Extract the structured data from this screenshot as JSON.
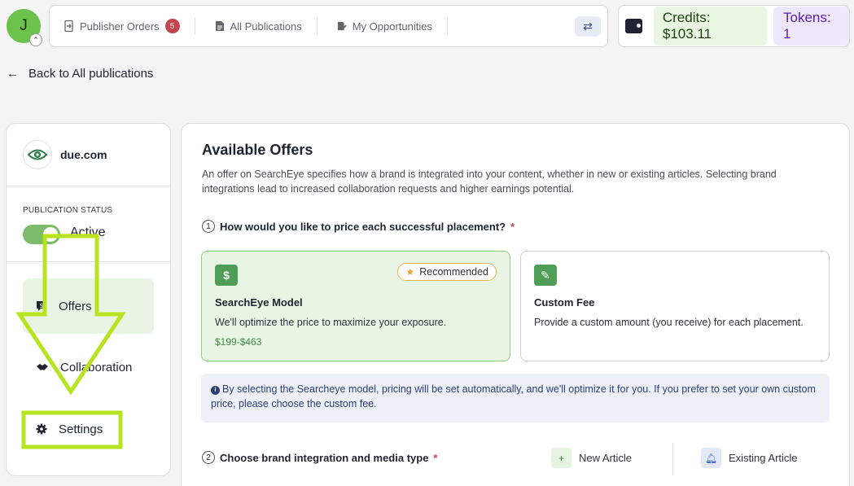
{
  "user": {
    "initial": "J"
  },
  "nav": {
    "items": [
      {
        "label": "Publisher Orders",
        "badge": "5"
      },
      {
        "label": "All Publications"
      },
      {
        "label": "My Opportunities"
      }
    ]
  },
  "wallet": {
    "credits": "Credits: $103.11",
    "tokens": "Tokens: 1"
  },
  "back_link": "Back to All publications",
  "publication": {
    "name": "due.com",
    "status_label": "PUBLICATION STATUS",
    "status": "Active"
  },
  "menu": [
    {
      "label": "Offers",
      "active": true
    },
    {
      "label": "Collaboration"
    },
    {
      "label": "Settings"
    }
  ],
  "main": {
    "title": "Available Offers",
    "description": "An offer on SearchEye specifies how a brand is integrated into your content, whether in new or existing articles. Selecting brand integrations lead to increased collaboration requests and higher earnings potential.",
    "question1": {
      "num": "1",
      "text": "How would you like to price each successful placement?",
      "required": "*"
    },
    "cards": [
      {
        "icon": "$",
        "title": "SearchEye Model",
        "text": "We'll optimize the price to maximize your exposure.",
        "price": "$199-$463",
        "badge": "Recommended"
      },
      {
        "icon": "✎",
        "title": "Custom Fee",
        "text": "Provide a custom amount (you receive) for each placement."
      }
    ],
    "info": "By selecting the Searcheye model, pricing will be set automatically, and we'll optimize it for you. If you prefer to set your own custom price, please choose the custom fee.",
    "question2": {
      "num": "2",
      "text": "Choose brand integration and media type",
      "required": "*"
    },
    "media_options": [
      {
        "label": "New Article"
      },
      {
        "label": "Existing Article"
      }
    ]
  },
  "colors": {
    "accent_green": "#4f9d57",
    "highlight": "#b7e31f",
    "badge_red": "#c4434e",
    "tokens_purple": "#5b21b6"
  }
}
